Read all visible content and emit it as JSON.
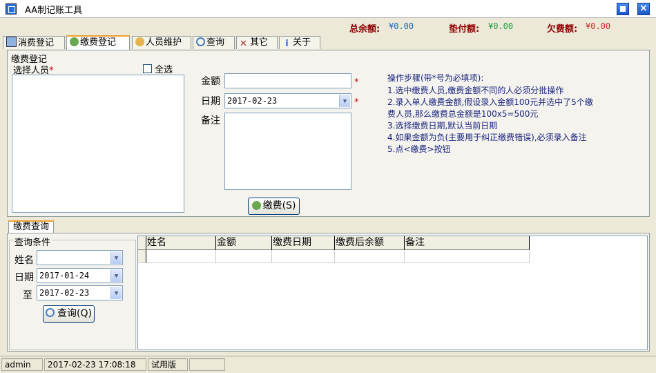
{
  "window": {
    "title": "AA制记账工具"
  },
  "summary": {
    "total_balance_label": "总余额:",
    "total_balance": "¥0.00",
    "advance_label": "垫付额:",
    "advance": "¥0.00",
    "owed_label": "欠费额:",
    "owed": "¥0.00"
  },
  "tabs": [
    "消费登记",
    "缴费登记",
    "人员维护",
    "查询",
    "其它",
    "关于"
  ],
  "payment_form": {
    "group_title": "缴费登记",
    "select_person_label": "选择人员",
    "select_all_label": "全选",
    "amount_label": "金额",
    "date_label": "日期",
    "date_value": "2017-02-23",
    "note_label": "备注",
    "required_mark": "*",
    "submit_label": "缴费(S)"
  },
  "instructions": [
    "操作步骤(带*号为必填项):",
    "1.选中缴费人员,缴费金额不同的人必须分批操作",
    "2.录入单人缴费金额,假设录入金额100元并选中了5个缴",
    "费人员,那么缴费总金额是100x5=500元",
    "3.选择缴费日期,默认当前日期",
    "4.如果金额为负(主要用于纠正缴费错误),必须录入备注",
    "5.点<缴费>按钮"
  ],
  "query": {
    "tab_label": "缴费查询",
    "group_title": "查询条件",
    "name_label": "姓名",
    "date_label": "日期",
    "to_label": "至",
    "date_from": "2017-01-24",
    "date_to": "2017-02-23",
    "search_label": "查询(Q)"
  },
  "grid": {
    "columns": [
      "姓名",
      "金额",
      "缴费日期",
      "缴费后余额",
      "备注"
    ]
  },
  "status": {
    "user": "admin",
    "datetime": "2017-02-23 17:08:18",
    "edition": "试用版"
  },
  "colors": {
    "accent_tab": "#f0a030",
    "summary_label": "#8b0000",
    "instruction_text": "#1a237e",
    "required": "#cc0000"
  }
}
